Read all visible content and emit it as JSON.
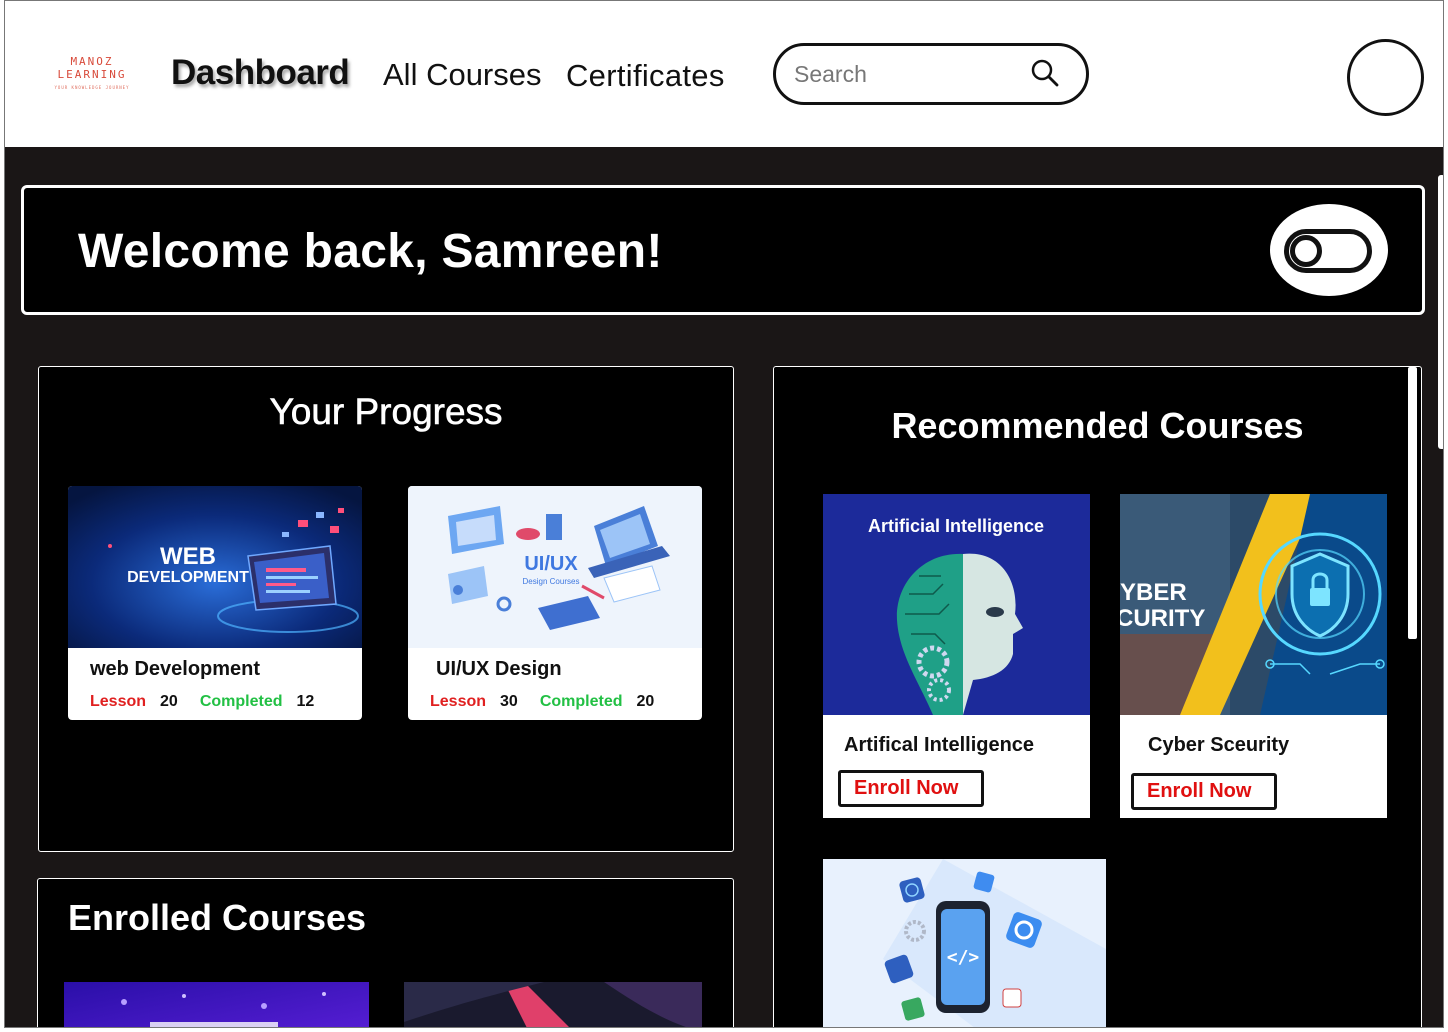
{
  "logo": {
    "line1": "MANOZ",
    "line2": "LEARNING",
    "tagline": "YOUR KNOWLEDGE JOURNEY"
  },
  "nav": {
    "dashboard": "Dashboard",
    "all_courses": "All Courses",
    "certificates": "Certificates"
  },
  "search": {
    "placeholder": "Search",
    "icon": "search-icon"
  },
  "welcome": {
    "text": "Welcome back, Samreen!",
    "toggle_icon": "theme-toggle-icon"
  },
  "progress": {
    "title": "Your Progress",
    "cards": [
      {
        "image_title": "WEB",
        "image_subtitle": "DEVELOPMENT",
        "name": "web Development",
        "lesson_label": "Lesson",
        "lessons": "20",
        "completed_label": "Completed",
        "completed": "12"
      },
      {
        "image_title": "UI/UX",
        "image_subtitle": "Design Courses",
        "name": "UI/UX Design",
        "lesson_label": "Lesson",
        "lessons": "30",
        "completed_label": "Completed",
        "completed": "20"
      }
    ]
  },
  "recommended": {
    "title": "Recommended Courses",
    "cards": [
      {
        "image_title": "Artificial Intelligence",
        "name": "Artifical Intelligence",
        "button": "Enroll Now"
      },
      {
        "image_title": "YBER\nCURITY",
        "name": "Cyber Sceurity",
        "button": "Enroll Now"
      }
    ]
  },
  "enrolled": {
    "title": "Enrolled Courses"
  },
  "colors": {
    "accent_red": "#e02020",
    "accent_green": "#22c044",
    "background": "#1a1616",
    "panel": "#000000"
  }
}
